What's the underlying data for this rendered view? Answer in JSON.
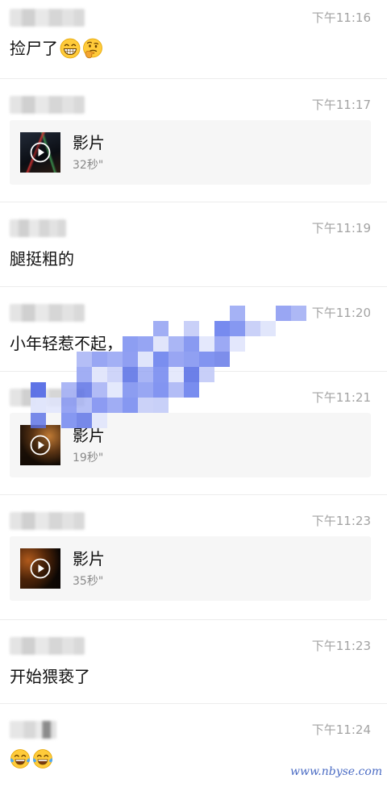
{
  "messages": [
    {
      "time": "下午11:16",
      "text": "捡尸了",
      "emoji": [
        "grinning-face-icon",
        "thinking-face-icon"
      ]
    },
    {
      "time": "下午11:17",
      "card": {
        "title": "影片",
        "duration": "32秒\"",
        "icon": "play-icon"
      }
    },
    {
      "time": "下午11:19",
      "text": "腿挺粗的"
    },
    {
      "time": "下午11:20",
      "text": "小年轻惹不起，"
    },
    {
      "time": "下午11:21",
      "card": {
        "title": "影片",
        "duration": "19秒\"",
        "icon": "play-icon"
      }
    },
    {
      "time": "下午11:23",
      "card": {
        "title": "影片",
        "duration": "35秒\"",
        "icon": "play-icon"
      }
    },
    {
      "time": "下午11:23",
      "text": "开始猥亵了"
    },
    {
      "time": "下午11:24",
      "emoji": [
        "face-with-tears-of-joy-icon",
        "face-with-tears-of-joy-icon"
      ]
    }
  ],
  "watermark": "www.nbyse.com",
  "colors": {
    "time": "#a3a3a3",
    "text": "#111111",
    "card_background": "#f6f6f6",
    "divider": "#ececec",
    "mosaic": "#6f84ee",
    "watermark": "#4b6cc4"
  }
}
